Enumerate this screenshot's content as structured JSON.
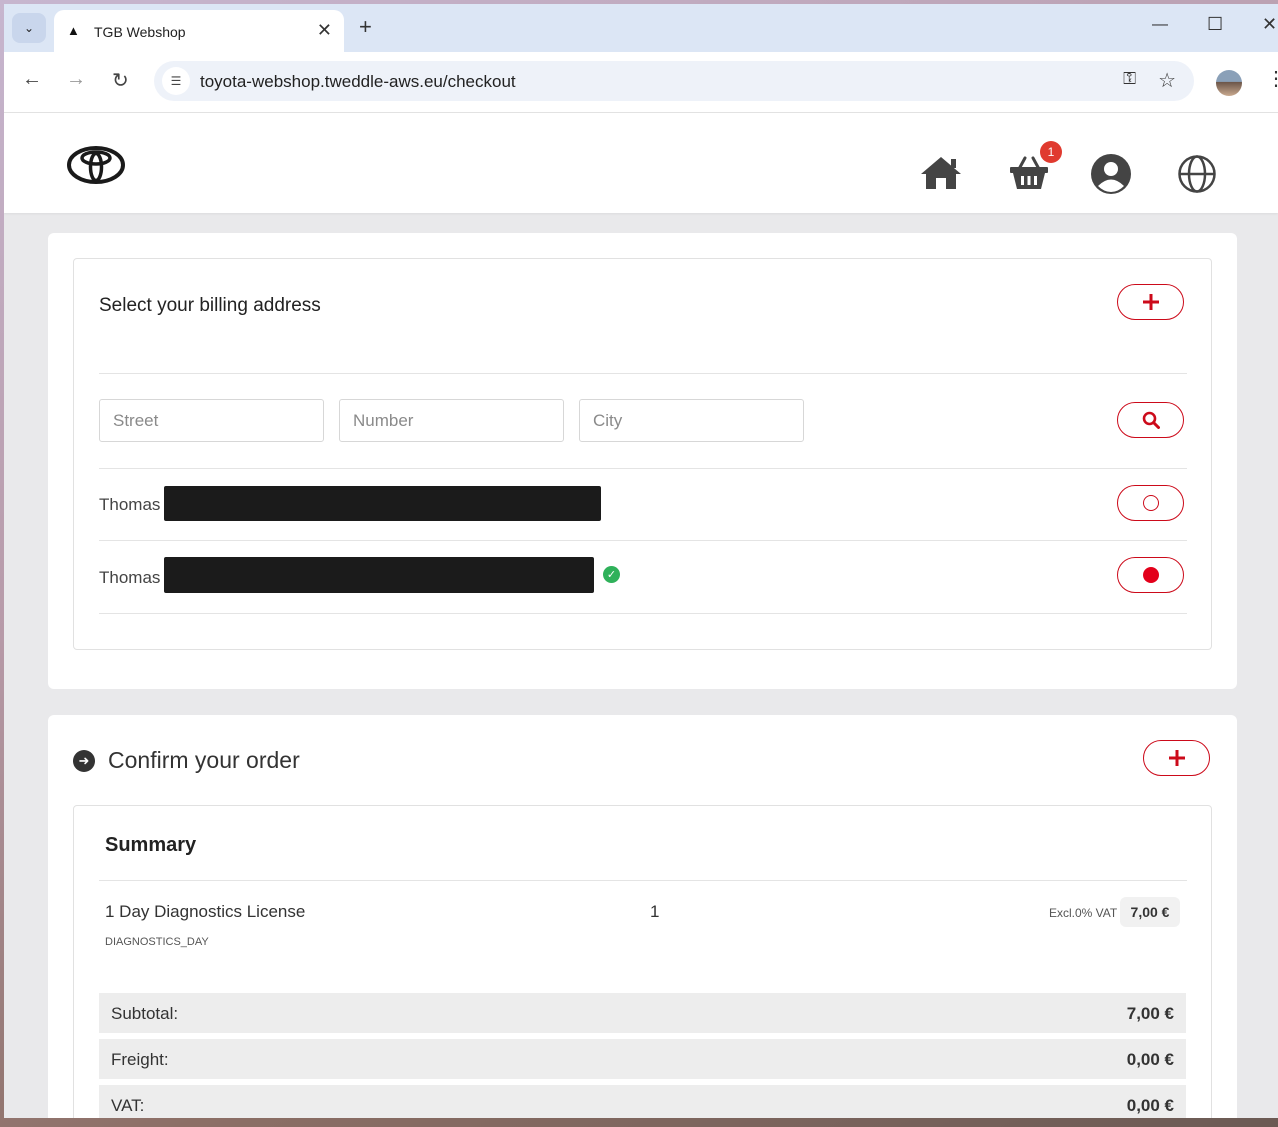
{
  "browser": {
    "tab_title": "TGB Webshop",
    "url": "toyota-webshop.tweddle-aws.eu/checkout"
  },
  "header": {
    "cart_badge": "1",
    "icons": [
      "home-icon",
      "cart-icon",
      "user-icon",
      "globe-icon"
    ]
  },
  "billing": {
    "title": "Select your billing address",
    "search": {
      "street_placeholder": "Street",
      "number_placeholder": "Number",
      "city_placeholder": "City"
    },
    "addresses": [
      {
        "name": "Thomas",
        "selected": false,
        "verified": false
      },
      {
        "name": "Thomas",
        "selected": true,
        "verified": true
      }
    ]
  },
  "order": {
    "title": "Confirm your order",
    "summary_title": "Summary",
    "items": [
      {
        "name": "1 Day Diagnostics License",
        "code": "DIAGNOSTICS_DAY",
        "quantity": "1",
        "vat_note": "Excl.0% VAT",
        "price": "7,00 €"
      }
    ],
    "totals": [
      {
        "label": "Subtotal:",
        "value": "7,00 €"
      },
      {
        "label": "Freight:",
        "value": "0,00 €"
      },
      {
        "label": "VAT:",
        "value": "0,00 €"
      }
    ]
  },
  "colors": {
    "accent": "#cc0a1a",
    "badge": "#e03a2f",
    "verified": "#2fb15a"
  }
}
